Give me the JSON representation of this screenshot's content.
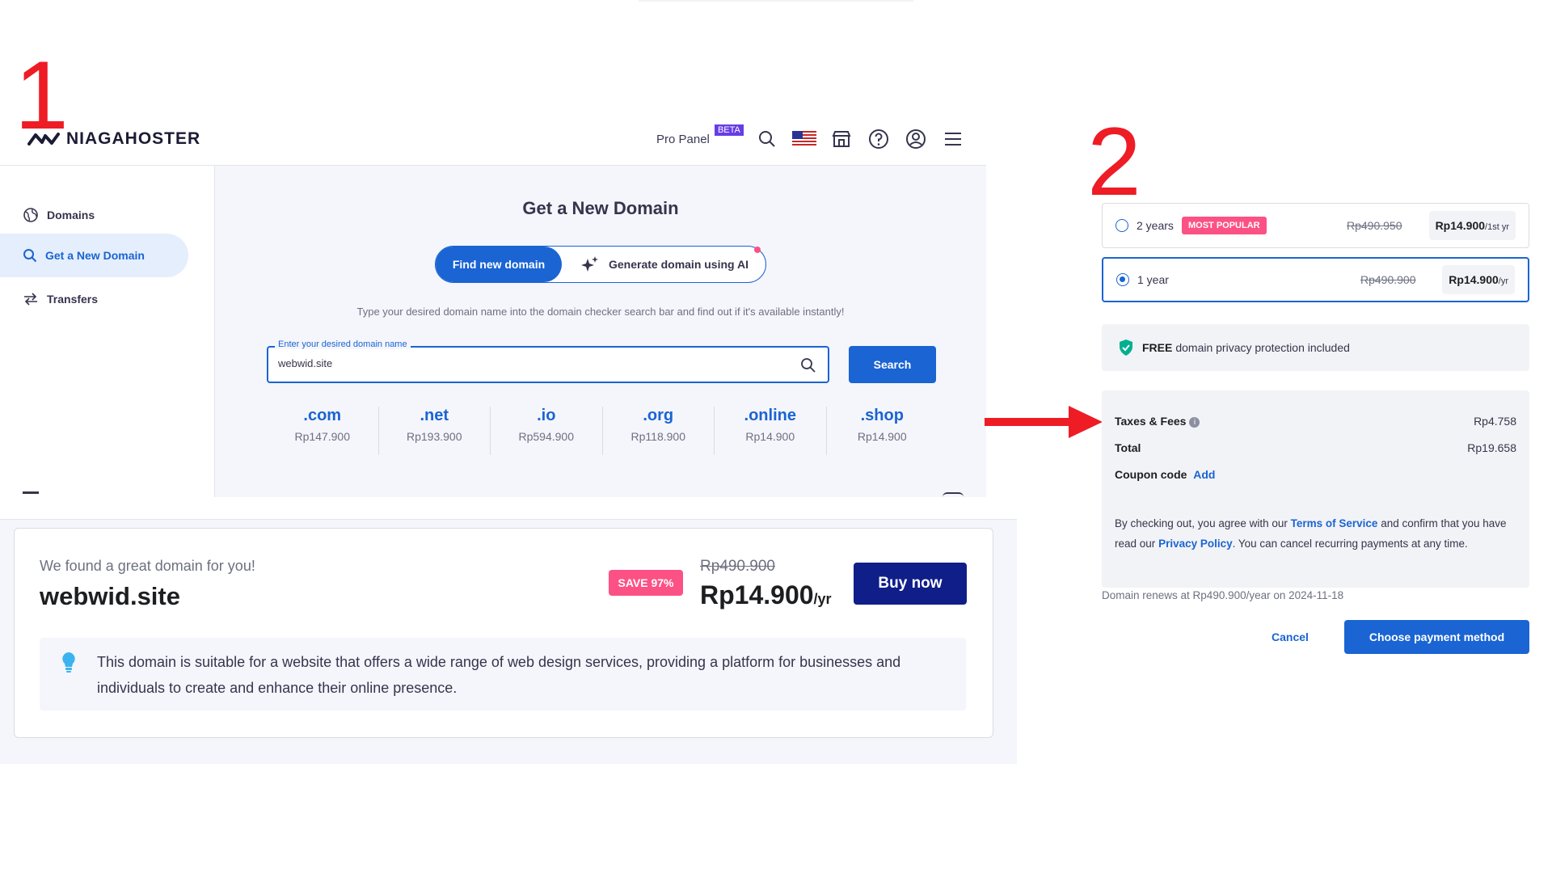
{
  "annotations": {
    "step1": "1",
    "step2": "2"
  },
  "header": {
    "logo_text": "NIAGAHOSTER",
    "pro_panel": "Pro Panel",
    "beta": "BETA",
    "icons": [
      "search-icon",
      "us-flag-icon",
      "store-icon",
      "help-icon",
      "account-icon",
      "menu-icon"
    ]
  },
  "sidebar": {
    "items": [
      {
        "label": "Domains",
        "icon": "globe-icon",
        "active": false
      },
      {
        "label": "Get a New Domain",
        "icon": "search-icon",
        "active": true
      },
      {
        "label": "Transfers",
        "icon": "transfer-icon",
        "active": false
      }
    ]
  },
  "main": {
    "title": "Get a New Domain",
    "toggle": {
      "find": "Find new domain",
      "ai": "Generate domain using AI"
    },
    "hint": "Type your desired domain name into the domain checker search bar and find out if it's available instantly!",
    "search": {
      "label": "Enter your desired domain name",
      "value": "webwid.site",
      "button": "Search"
    },
    "tlds": [
      {
        "name": ".com",
        "price": "Rp147.900"
      },
      {
        "name": ".net",
        "price": "Rp193.900"
      },
      {
        "name": ".io",
        "price": "Rp594.900"
      },
      {
        "name": ".org",
        "price": "Rp118.900"
      },
      {
        "name": ".online",
        "price": "Rp14.900"
      },
      {
        "name": ".shop",
        "price": "Rp14.900"
      }
    ]
  },
  "result": {
    "found_label": "We found a great domain for you!",
    "domain": "webwid.site",
    "save_badge": "SAVE 97%",
    "old_price": "Rp490.900",
    "new_price": "Rp14.900",
    "new_price_unit": "/yr",
    "buy_button": "Buy now",
    "tip": "This domain is suitable for a website that offers a wide range of web design services, providing a platform for businesses and individuals to create and enhance their online presence."
  },
  "checkout": {
    "plans": [
      {
        "label": "2 years",
        "badge": "MOST POPULAR",
        "old_price": "Rp490.950",
        "price": "Rp14.900",
        "unit": "/1st yr",
        "selected": false
      },
      {
        "label": "1 year",
        "old_price": "Rp490.900",
        "price": "Rp14.900",
        "unit": "/yr",
        "selected": true
      }
    ],
    "privacy_bold": "FREE",
    "privacy_text": "domain privacy protection included",
    "taxes_label": "Taxes & Fees",
    "taxes_value": "Rp4.758",
    "total_label": "Total",
    "total_value": "Rp19.658",
    "coupon_label": "Coupon code",
    "coupon_link": "Add",
    "terms_prefix": "By checking out, you agree with our",
    "terms_link": "Terms of Service",
    "terms_mid": "and confirm that you have read our",
    "privacy_link": "Privacy Policy",
    "terms_suffix": ". You can cancel recurring payments at any time.",
    "renews": "Domain renews at Rp490.900/year on 2024-11-18",
    "cancel": "Cancel",
    "pay": "Choose payment method"
  },
  "colors": {
    "primary": "#1a64d3",
    "badge": "#fc5185",
    "buy": "#101e89",
    "annotation": "#ee1c25"
  }
}
